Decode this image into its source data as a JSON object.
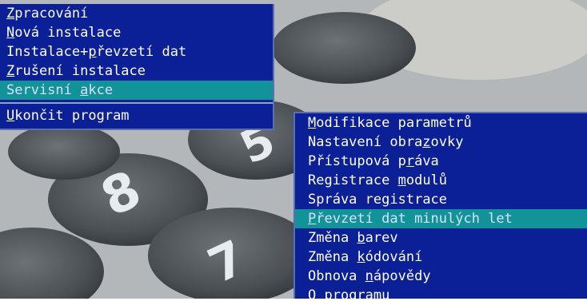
{
  "main_menu": {
    "items": [
      {
        "pre": "",
        "key": "Z",
        "post": "pracování"
      },
      {
        "pre": "",
        "key": "N",
        "post": "ová instalace"
      },
      {
        "pre": "Instalace+",
        "key": "p",
        "post": "řevzetí dat"
      },
      {
        "pre": "",
        "key": "Z",
        "post": "rušení instalace"
      },
      {
        "pre": "Servisní ",
        "key": "a",
        "post": "kce"
      }
    ],
    "exit": {
      "pre": "",
      "key": "U",
      "post": "končit program"
    }
  },
  "sub_menu": {
    "items": [
      {
        "pre": "",
        "key": "M",
        "post": "odifikace parametrů"
      },
      {
        "pre": "Nastavení obra",
        "key": "z",
        "post": "ovky"
      },
      {
        "pre": "Přístupová p",
        "key": "r",
        "post": "áva"
      },
      {
        "pre": "Registrace ",
        "key": "m",
        "post": "odulů"
      },
      {
        "pre": "Správa re",
        "key": "g",
        "post": "istrace"
      },
      {
        "pre": "",
        "key": "P",
        "post": "řevzetí dat minulých let"
      },
      {
        "pre": "Změna ",
        "key": "b",
        "post": "arev"
      },
      {
        "pre": "Změna ",
        "key": "k",
        "post": "ódování"
      },
      {
        "pre": "Obnova ",
        "key": "n",
        "post": "ápovědy"
      },
      {
        "pre": "",
        "key": "O",
        "post": " programu"
      }
    ]
  },
  "colors": {
    "menu_bg": "#0b1f97",
    "highlight": "#12939a",
    "text": "#ffffff"
  }
}
